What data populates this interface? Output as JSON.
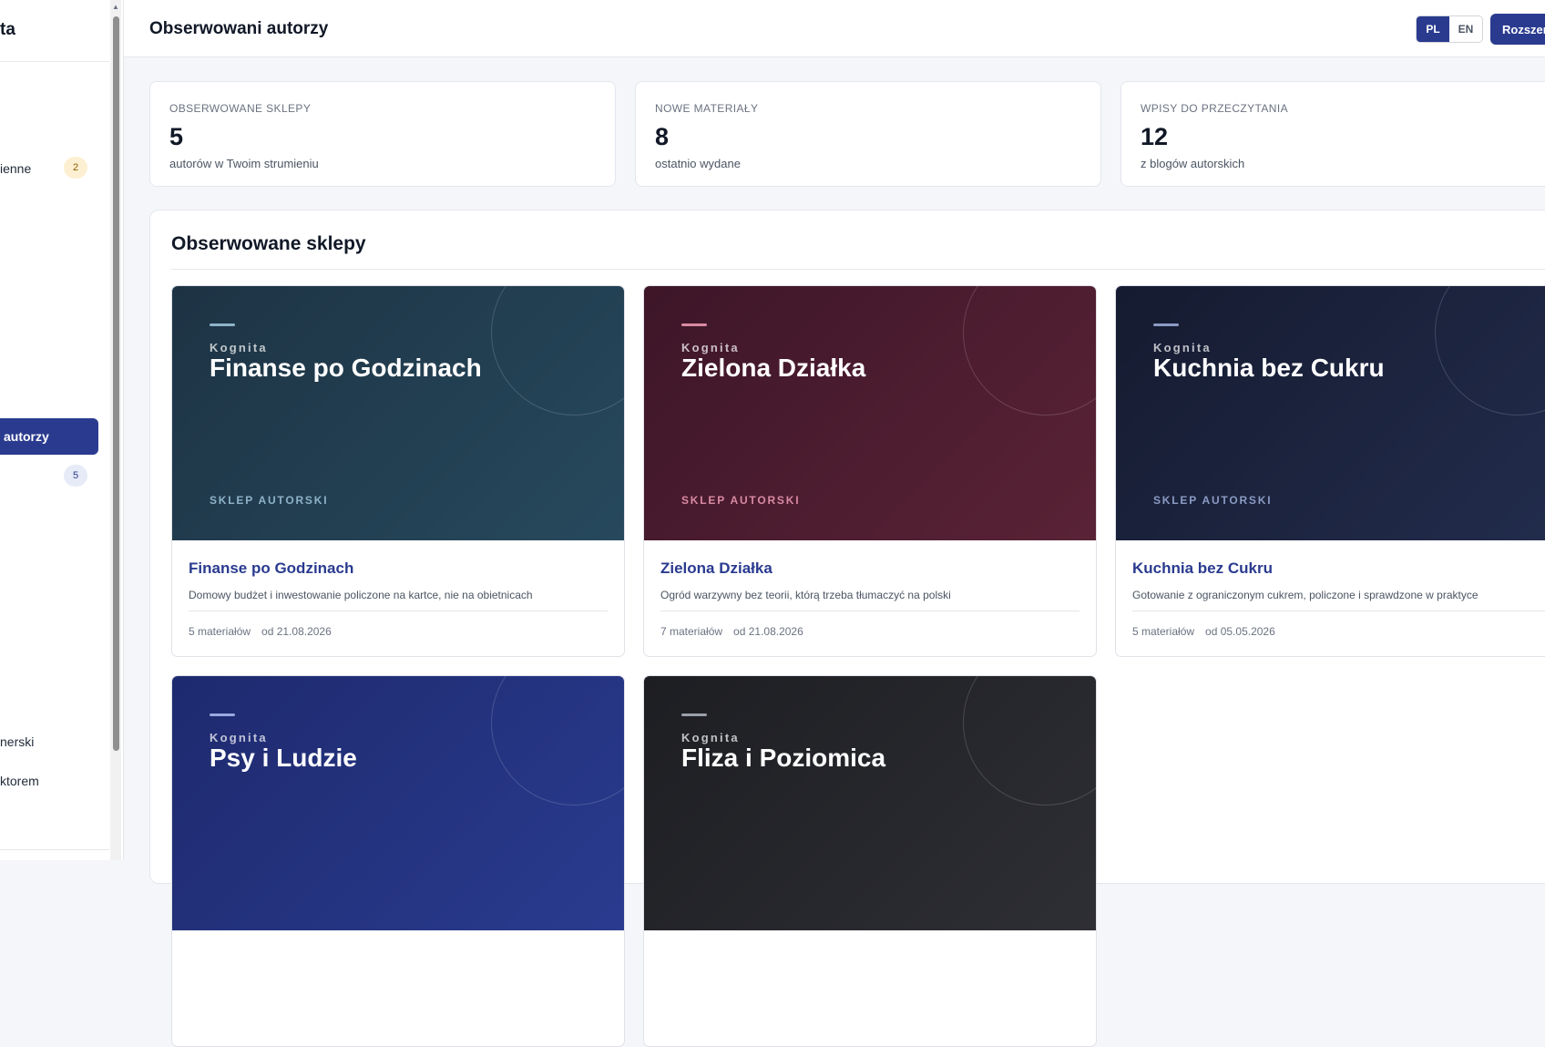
{
  "sidebar": {
    "brand": "ta",
    "items": [
      {
        "label": "ienne",
        "badge": "2"
      },
      {
        "label": "autorzy",
        "active": true
      },
      {
        "label": "",
        "badge": "5"
      },
      {
        "label": "nerski"
      },
      {
        "label": "ktorem"
      }
    ]
  },
  "header": {
    "title": "Obserwowani autorzy",
    "lang_pl": "PL",
    "lang_en": "EN",
    "cta_label": "Rozszerz"
  },
  "stats": [
    {
      "label": "OBSERWOWANE SKLEPY",
      "value": "5",
      "desc": "autorów w Twoim strumieniu"
    },
    {
      "label": "NOWE MATERIAŁY",
      "value": "8",
      "desc": "ostatnio wydane"
    },
    {
      "label": "WPISY DO PRZECZYTANIA",
      "value": "12",
      "desc": "z blogów autorskich"
    }
  ],
  "shops": {
    "section_title": "Obserwowane sklepy",
    "cards": [
      {
        "brand": "Kognita",
        "cover_title": "Finanse po Godzinach",
        "tag": "SKLEP AUTORSKI",
        "title": "Finanse po Godzinach",
        "desc": "Domowy budżet i inwestowanie policzone na kartce, nie na obietnicach",
        "materials": "5 materiałów",
        "since": "od 21.08.2026",
        "colors": {
          "from": "#1d3344",
          "to": "#27495d",
          "accent": "#8fb3c9"
        }
      },
      {
        "brand": "Kognita",
        "cover_title": "Zielona Działka",
        "tag": "SKLEP AUTORSKI",
        "title": "Zielona Działka",
        "desc": "Ogród warzywny bez teorii, którą trzeba tłumaczyć na polski",
        "materials": "7 materiałów",
        "since": "od 21.08.2026",
        "colors": {
          "from": "#3d1628",
          "to": "#5a2236",
          "accent": "#d98aa3"
        }
      },
      {
        "brand": "Kognita",
        "cover_title": "Kuchnia bez Cukru",
        "tag": "SKLEP AUTORSKI",
        "title": "Kuchnia bez Cukru",
        "desc": "Gotowanie z ograniczonym cukrem, policzone i sprawdzone w praktyce",
        "materials": "5 materiałów",
        "since": "od 05.05.2026",
        "colors": {
          "from": "#151b30",
          "to": "#222c4c",
          "accent": "#8c9bc4"
        }
      },
      {
        "brand": "Kognita",
        "cover_title": "Psy i Ludzie",
        "colors": {
          "from": "#1e2a6e",
          "to": "#2a3b8f",
          "accent": "#9aa8e0"
        }
      },
      {
        "brand": "Kognita",
        "cover_title": "Fliza i Poziomica",
        "colors": {
          "from": "#1d1e22",
          "to": "#2e2f35",
          "accent": "#9aa0aa"
        }
      }
    ]
  }
}
